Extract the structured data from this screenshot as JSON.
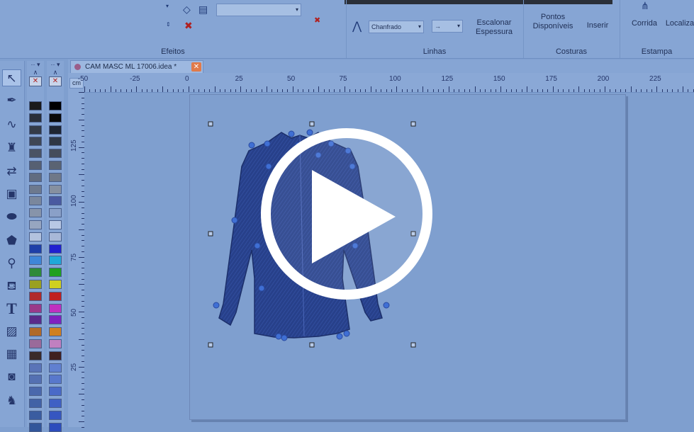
{
  "ribbon": {
    "groups": [
      {
        "label": "Efeitos"
      },
      {
        "label": "Linhas"
      },
      {
        "label": "Costuras"
      },
      {
        "label": "Estampa"
      }
    ],
    "linhas": {
      "corner_combo": "Chanfrado",
      "arrow_combo": "→",
      "scale_label_1": "Escalonar",
      "scale_label_2": "Espessura"
    },
    "costuras": {
      "points_1": "Pontos",
      "points_2": "Disponíveis",
      "insert": "Inserir"
    },
    "estampa": {
      "run": "Corrida",
      "locate": "Localiza"
    }
  },
  "tab": {
    "title": "CAM MASC ML 17006.idea *",
    "close": "✕"
  },
  "ruler": {
    "unit": "cm",
    "h_labels": [
      "-50",
      "-25",
      "0",
      "25",
      "50",
      "75",
      "100",
      "125",
      "150",
      "175",
      "200",
      "225"
    ],
    "v_labels": [
      "125",
      "100",
      "75",
      "50",
      "25"
    ]
  },
  "palette_a": [
    "#1a1a1a",
    "#2a2f3a",
    "#343b48",
    "#3f4756",
    "#4a5364",
    "#566072",
    "#616c80",
    "#6d798e",
    "#7a879d",
    "#8794aa",
    "#97a6c0",
    "#b2c2de",
    "#1e3fa8",
    "#3f86d8",
    "#2f8a3a",
    "#9aa020",
    "#b02a2a",
    "#9a3a8a",
    "#5a2a8a",
    "#b06a2a",
    "#9a6a9a",
    "#3a2a2a",
    "#5a74b8",
    "#5470b2",
    "#4a68ac",
    "#4262a6",
    "#3a5ca0",
    "#32569a"
  ],
  "palette_b": [
    "#000000",
    "#0a0a0a",
    "#1e2532",
    "#2f3745",
    "#454d5b",
    "#5a6372",
    "#6f7888",
    "#8690a0",
    "#4a5aa0",
    "#8aa0c8",
    "#b8c8e4",
    "#a8b8d8",
    "#2020d0",
    "#20a8d8",
    "#20a020",
    "#d0d020",
    "#c02020",
    "#c030c0",
    "#8020c0",
    "#d08020",
    "#c080c0",
    "#402020",
    "#6080d0",
    "#5878cc",
    "#4a6ac8",
    "#4060c4",
    "#3656c0",
    "#2c4cbc"
  ]
}
